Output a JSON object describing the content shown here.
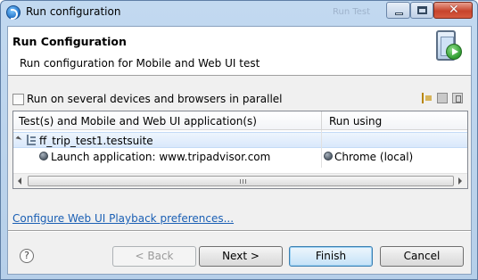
{
  "window": {
    "title": "Run configuration",
    "background_title": "Run Test",
    "controls": {
      "minimize": "minimize",
      "maximize": "maximize",
      "close": "✕"
    }
  },
  "header": {
    "title": "Run Configuration",
    "description": "Run configuration for Mobile and Web UI test",
    "icon": "mobile-run-icon"
  },
  "parallel": {
    "label": "Run on several devices and browsers in parallel",
    "checked": false
  },
  "toolbar_icons": [
    "add-config-icon",
    "copy-config-icon",
    "remove-config-icon"
  ],
  "table": {
    "columns": [
      "Test(s) and Mobile and Web UI application(s)",
      "Run using"
    ],
    "rows": [
      {
        "label": "ff_trip_test1.testsuite",
        "run_using": "",
        "expanded": true,
        "icon": "testsuite-icon"
      },
      {
        "label": "Launch application: www.tripadvisor.com",
        "run_using": "Chrome (local)",
        "icon": "globe-icon",
        "run_icon": "globe-icon"
      }
    ]
  },
  "link": {
    "text": "Configure Web UI Playback preferences..."
  },
  "buttons": {
    "help": "?",
    "back": "< Back",
    "next": "Next >",
    "finish": "Finish",
    "cancel": "Cancel"
  }
}
